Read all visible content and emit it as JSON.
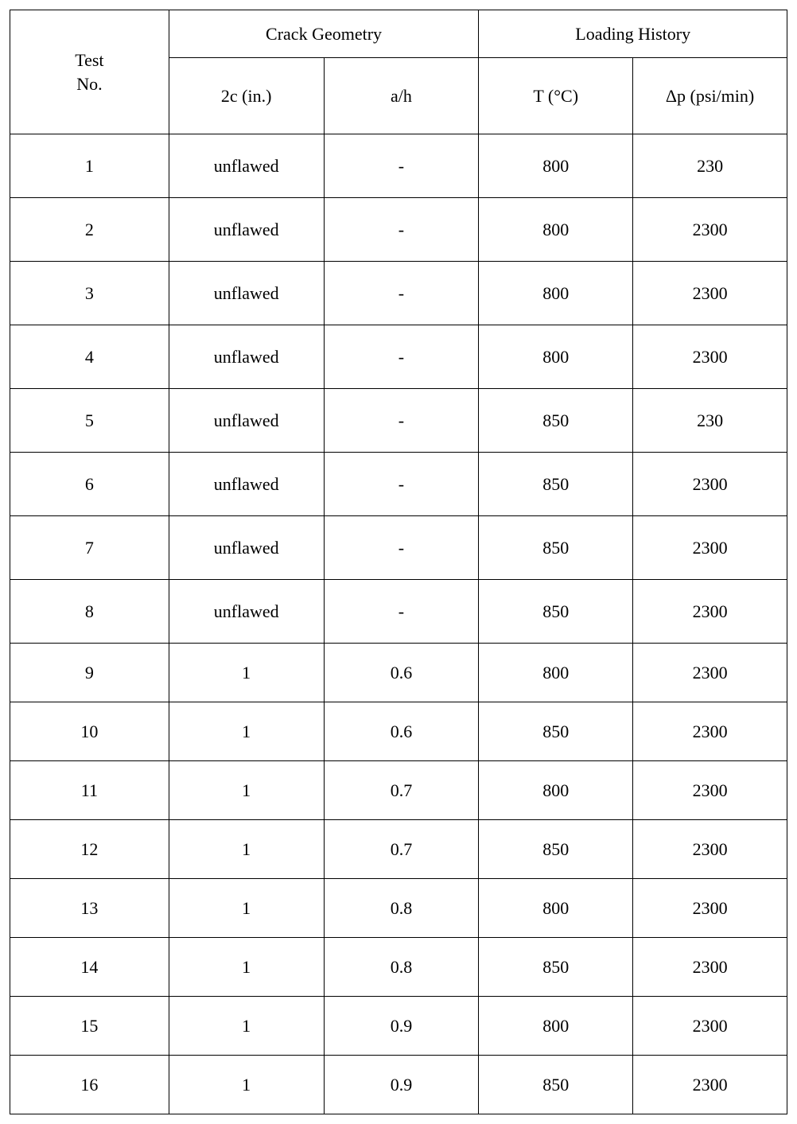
{
  "headers": {
    "test_no": "Test\nNo.",
    "crack_geometry": "Crack  Geometry",
    "loading_history": "Loading  History",
    "col_2c": "2c  (in.)",
    "col_ah": "a/h",
    "col_t": "T  (°C)",
    "col_dp": "Δp  (psi/min)"
  },
  "rows": [
    {
      "no": "1",
      "c2": "unflawed",
      "ah": "-",
      "t": "800",
      "dp": "230"
    },
    {
      "no": "2",
      "c2": "unflawed",
      "ah": "-",
      "t": "800",
      "dp": "2300"
    },
    {
      "no": "3",
      "c2": "unflawed",
      "ah": "-",
      "t": "800",
      "dp": "2300"
    },
    {
      "no": "4",
      "c2": "unflawed",
      "ah": "-",
      "t": "800",
      "dp": "2300"
    },
    {
      "no": "5",
      "c2": "unflawed",
      "ah": "-",
      "t": "850",
      "dp": "230"
    },
    {
      "no": "6",
      "c2": "unflawed",
      "ah": "-",
      "t": "850",
      "dp": "2300"
    },
    {
      "no": "7",
      "c2": "unflawed",
      "ah": "-",
      "t": "850",
      "dp": "2300"
    },
    {
      "no": "8",
      "c2": "unflawed",
      "ah": "-",
      "t": "850",
      "dp": "2300"
    },
    {
      "no": "9",
      "c2": "1",
      "ah": "0.6",
      "t": "800",
      "dp": "2300"
    },
    {
      "no": "10",
      "c2": "1",
      "ah": "0.6",
      "t": "850",
      "dp": "2300"
    },
    {
      "no": "11",
      "c2": "1",
      "ah": "0.7",
      "t": "800",
      "dp": "2300"
    },
    {
      "no": "12",
      "c2": "1",
      "ah": "0.7",
      "t": "850",
      "dp": "2300"
    },
    {
      "no": "13",
      "c2": "1",
      "ah": "0.8",
      "t": "800",
      "dp": "2300"
    },
    {
      "no": "14",
      "c2": "1",
      "ah": "0.8",
      "t": "850",
      "dp": "2300"
    },
    {
      "no": "15",
      "c2": "1",
      "ah": "0.9",
      "t": "800",
      "dp": "2300"
    },
    {
      "no": "16",
      "c2": "1",
      "ah": "0.9",
      "t": "850",
      "dp": "2300"
    }
  ]
}
